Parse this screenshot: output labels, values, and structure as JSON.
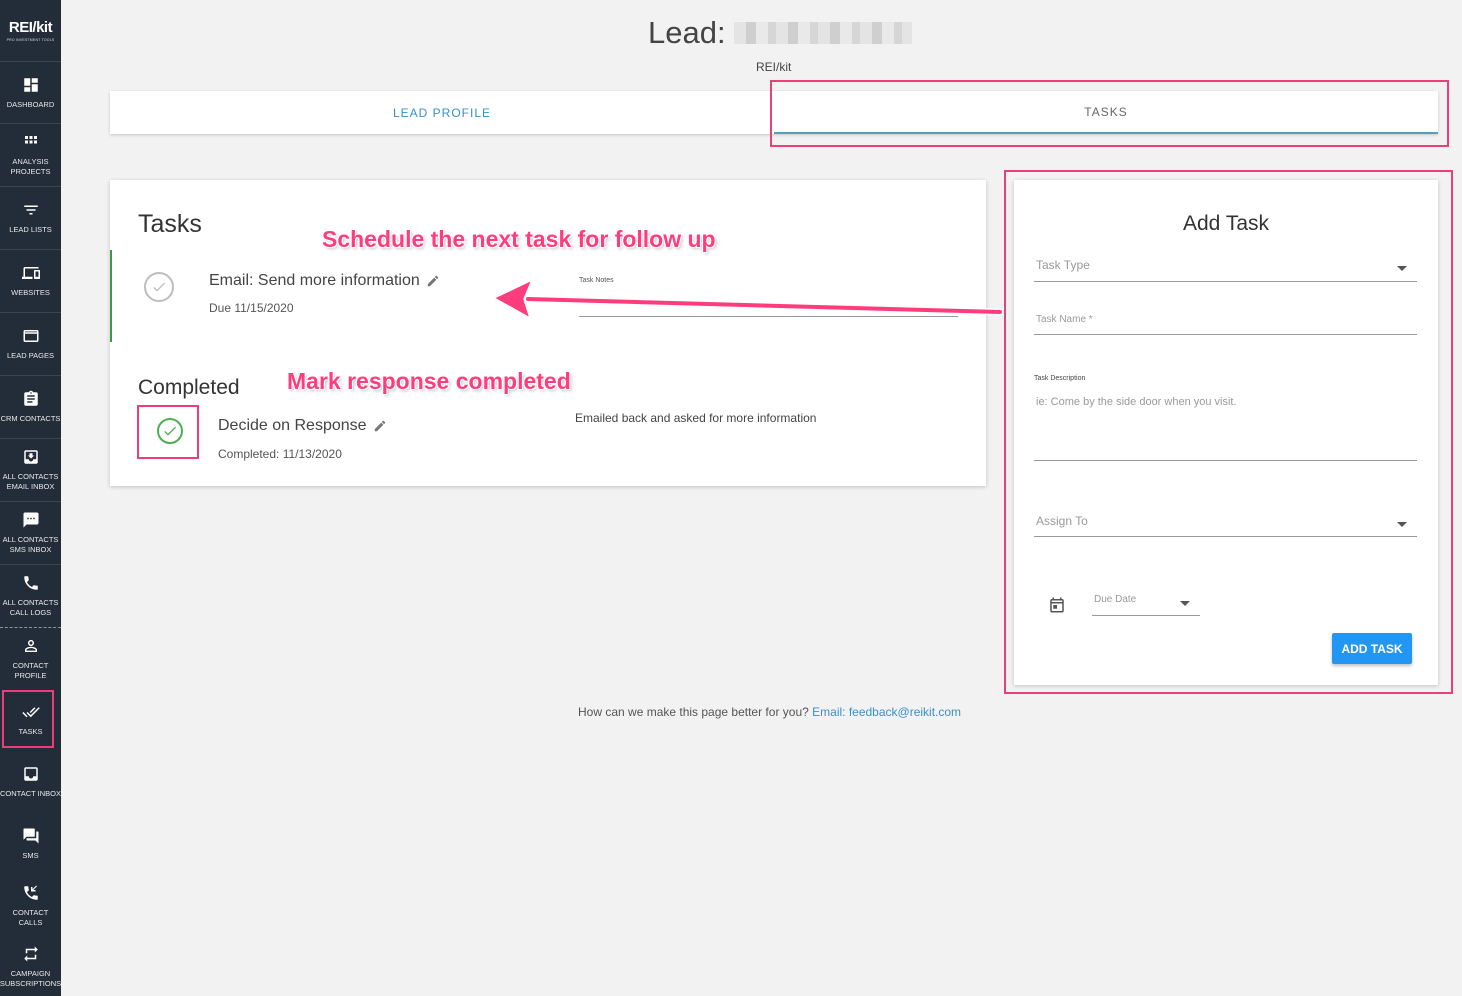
{
  "logo": {
    "brand": "REI/kit",
    "tagline": "PRO INVESTMENT TOOLS"
  },
  "sidebar": {
    "items": [
      {
        "label": "DASHBOARD",
        "icon": "dashboard-icon"
      },
      {
        "label": "ANALYSIS PROJECTS",
        "icon": "grid-icon"
      },
      {
        "label": "LEAD LISTS",
        "icon": "filter-icon"
      },
      {
        "label": "WEBSITES",
        "icon": "devices-icon"
      },
      {
        "label": "LEAD PAGES",
        "icon": "web-icon"
      },
      {
        "label": "CRM CONTACTS",
        "icon": "clipboard-icon"
      },
      {
        "label": "ALL CONTACTS EMAIL INBOX",
        "icon": "inbox-icon"
      },
      {
        "label": "ALL CONTACTS SMS INBOX",
        "icon": "chat-icon"
      },
      {
        "label": "ALL CONTACTS CALL LOGS",
        "icon": "phone-icon"
      },
      {
        "label": "CONTACT PROFILE",
        "icon": "person-icon"
      },
      {
        "label": "TASKS",
        "icon": "double-check-icon"
      },
      {
        "label": "CONTACT INBOX",
        "icon": "tray-icon"
      },
      {
        "label": "SMS",
        "icon": "forum-icon"
      },
      {
        "label": "CONTACT CALLS",
        "icon": "call-received-icon"
      },
      {
        "label": "CAMPAIGN SUBSCRIPTIONS",
        "icon": "swap-icon"
      }
    ]
  },
  "header": {
    "title": "Lead:",
    "subtitle": "REI/kit"
  },
  "tabs": [
    {
      "label": "LEAD PROFILE"
    },
    {
      "label": "TASKS"
    }
  ],
  "tasks": {
    "title": "Tasks",
    "open": {
      "name": "Email: Send more information",
      "due": "Due 11/15/2020",
      "notes_label": "Task Notes"
    },
    "completed_title": "Completed",
    "completed": {
      "name": "Decide on Response",
      "date": "Completed: 11/13/2020",
      "notes": "Emailed back and asked for more information"
    }
  },
  "annotations": {
    "schedule": "Schedule the next task for follow up",
    "mark": "Mark response completed"
  },
  "add_task": {
    "title": "Add Task",
    "task_type": "Task Type",
    "task_name": "Task Name *",
    "task_description_label": "Task Description",
    "task_description_placeholder": "ie: Come by the side door when you visit.",
    "assign_to": "Assign To",
    "due_date": "Due Date",
    "button": "ADD TASK"
  },
  "feedback": {
    "text": "How can we make this page better for you?",
    "link": "Email: feedback@reikit.com"
  },
  "colors": {
    "accent": "#2196f3",
    "annotation": "#ea3f7a",
    "sidebar": "#232d3a",
    "success": "#3a9a46"
  }
}
